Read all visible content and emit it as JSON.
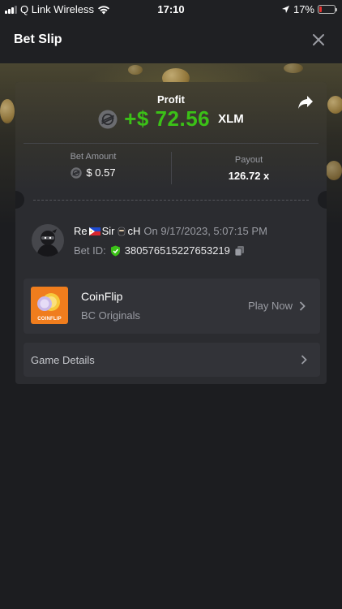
{
  "status_bar": {
    "carrier": "Q Link Wireless",
    "time": "17:10",
    "battery": "17%"
  },
  "header": {
    "title": "Bet Slip"
  },
  "profit": {
    "label": "Profit",
    "value": "+$ 72.56",
    "currency": "XLM",
    "color": "#3bc117"
  },
  "bet_amount": {
    "label": "Bet Amount",
    "value": "$ 0.57"
  },
  "payout": {
    "label": "Payout",
    "value": "126.72 x"
  },
  "player": {
    "name_part1": "Re",
    "name_part2": "Sir",
    "name_part3": "cH",
    "datetime_text": "On 9/17/2023, 5:07:15 PM",
    "bet_id_label": "Bet ID:",
    "bet_id": "380576515227653219"
  },
  "game": {
    "name": "CoinFlip",
    "provider": "BC Originals",
    "thumb_label": "COINFLIP",
    "play_label": "Play Now"
  },
  "details": {
    "label": "Game Details"
  },
  "icons": {
    "currency": "stellar-lumens-icon",
    "share": "share-arrow-icon",
    "close": "close-icon",
    "verified": "shield-check-icon",
    "copy": "copy-icon"
  }
}
